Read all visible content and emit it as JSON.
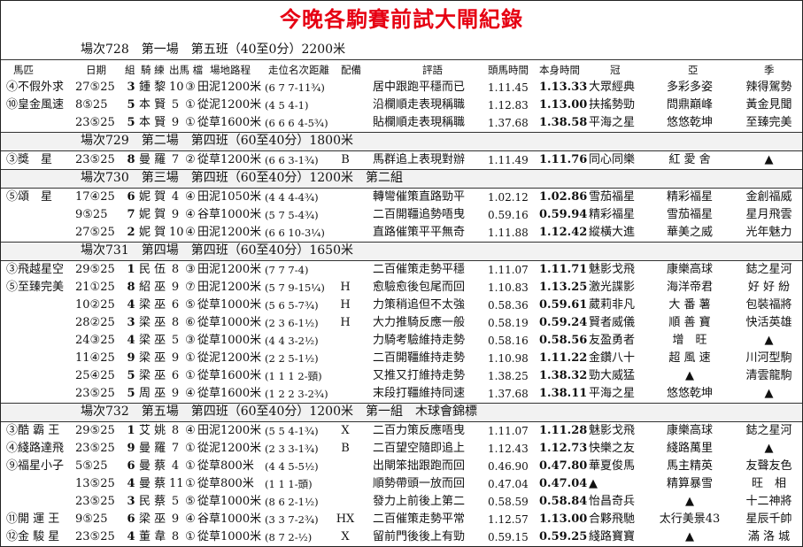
{
  "title": "今晚各駒賽前試大閘紀錄",
  "first_race_header": "場次728　第一場　第五班（40至0分）2200米",
  "columns": {
    "horse": "馬匹",
    "date": "日期",
    "group": "組",
    "jockey": "騎 練",
    "weight": "出馬 檔",
    "track": "場地路程",
    "running": "走位名次距離",
    "gear": "配備",
    "comment": "評語",
    "lead_time": "頭馬時間",
    "own_time": "本身時間",
    "first": "冠",
    "second": "亞",
    "third": "季"
  },
  "rows": [
    {
      "horse": "④不假外求",
      "date": "27⑤25",
      "group": "3",
      "jockey": "鍾 黎",
      "weight": "10",
      "gate": "③",
      "track": "田泥1200米",
      "running": "(6 7 7-11¾)",
      "gear": "",
      "comment": "居中跟跑平穩而已",
      "lead": "1.11.45",
      "own": "1.13.33",
      "first": "大眾經典",
      "second": "多彩多姿",
      "third": "辣得駕勢"
    },
    {
      "horse": "⑩皇金風速",
      "date": "8⑤25",
      "group": "5",
      "jockey": "本 賢",
      "weight": "5",
      "gate": "①",
      "track": "從泥1200米",
      "running": "(4 5 4-1)",
      "gear": "",
      "comment": "沿欄順走表現稱職",
      "lead": "1.12.83",
      "own": "1.13.00",
      "first": "扶搖勢勁",
      "second": "問鼎巔峰",
      "third": "黃金見聞"
    },
    {
      "horse": "",
      "date": "23⑤25",
      "group": "5",
      "jockey": "本 賢",
      "weight": "9",
      "gate": "①",
      "track": "從草1600米",
      "running": "(6 6 6 4-5¾)",
      "gear": "",
      "comment": "貼欄順走表現稱職",
      "lead": "1.37.68",
      "own": "1.38.58",
      "first": "平海之星",
      "second": "悠悠乾坤",
      "third": "至臻完美"
    },
    {
      "race": "場次729　第二場　第四班（60至40分）1800米"
    },
    {
      "horse": "③獎　星",
      "date": "23⑤25",
      "group": "8",
      "jockey": "曼 羅",
      "weight": "7",
      "gate": "②",
      "track": "從草1200米",
      "running": "(6 6 3-1¾)",
      "gear": "B",
      "comment": "馬群追上表現對辦",
      "lead": "1.11.49",
      "own": "1.11.76",
      "first": "同心同樂",
      "second": "紅 愛 舍",
      "third": "▲"
    },
    {
      "race": "場次730　第三場　第四班（60至40分）1200米　第二組"
    },
    {
      "horse": "⑤頌　星",
      "date": "17④25",
      "group": "6",
      "jockey": "妮 賀",
      "weight": "4",
      "gate": "④",
      "track": "田泥1050米",
      "running": "(4 4 4-4¾)",
      "gear": "",
      "comment": "轉彎催策直路勁平",
      "lead": "1.02.12",
      "own": "1.02.86",
      "first": "雪茄福星",
      "second": "精彩福星",
      "third": "金創福威"
    },
    {
      "horse": "",
      "date": "9⑤25",
      "group": "7",
      "jockey": "妮 賀",
      "weight": "9",
      "gate": "④",
      "track": "谷草1000米",
      "running": "(5 7 5-4¾)",
      "gear": "",
      "comment": "二百開韁追勢唔曳",
      "lead": "0.59.16",
      "own": "0.59.94",
      "first": "精彩福星",
      "second": "雪茄福星",
      "third": "星月飛雲"
    },
    {
      "horse": "",
      "date": "27⑤25",
      "group": "2",
      "jockey": "妮 賀",
      "weight": "10",
      "gate": "④",
      "track": "田泥1200米",
      "running": "(6 6 10-3¼)",
      "gear": "",
      "comment": "直路催策平平無奇",
      "lead": "1.11.88",
      "own": "1.12.42",
      "first": "縱橫大進",
      "second": "華美之威",
      "third": "光年魅力"
    },
    {
      "race": "場次731　第四場　第四班（60至40分）1650米"
    },
    {
      "horse": "③飛越星空",
      "date": "29⑤25",
      "group": "1",
      "jockey": "民 伍",
      "weight": "8",
      "gate": "③",
      "track": "田泥1200米",
      "running": "(7 7 7-4)",
      "gear": "",
      "comment": "二百催策走勢平穩",
      "lead": "1.11.07",
      "own": "1.11.71",
      "first": "魅影戈飛",
      "second": "康樂高球",
      "third": "鋕之星河"
    },
    {
      "horse": "⑤至臻完美",
      "date": "21①25",
      "group": "8",
      "jockey": "紹 巫",
      "weight": "9",
      "gate": "⑦",
      "track": "田泥1200米",
      "running": "(5 7 9-15¼)",
      "gear": "H",
      "comment": "愈驗愈後包尾而回",
      "lead": "1.10.83",
      "own": "1.13.25",
      "first": "激光諜影",
      "second": "海洋帝君",
      "third": "好 好 紛"
    },
    {
      "horse": "",
      "date": "10②25",
      "group": "4",
      "jockey": "梁 巫",
      "weight": "6",
      "gate": "⑤",
      "track": "從草1000米",
      "running": "(5 6 5-7¾)",
      "gear": "H",
      "comment": "力策稍追但不太強",
      "lead": "0.58.36",
      "own": "0.59.61",
      "first": "葳莉非凡",
      "second": "大 番 薯",
      "third": "包裝福將"
    },
    {
      "horse": "",
      "date": "28②25",
      "group": "3",
      "jockey": "梁 巫",
      "weight": "8",
      "gate": "⑥",
      "track": "從草1000米",
      "running": "(2 3 6-1½)",
      "gear": "H",
      "comment": "大力推騎反應一般",
      "lead": "0.58.19",
      "own": "0.59.24",
      "first": "賢者威儀",
      "second": "順 善 寶",
      "third": "快活英雄"
    },
    {
      "horse": "",
      "date": "24③25",
      "group": "4",
      "jockey": "梁 巫",
      "weight": "5",
      "gate": "③",
      "track": "從草1000米",
      "running": "(4 4 3-2½)",
      "gear": "",
      "comment": "力騎考驗維持走勢",
      "lead": "0.58.16",
      "own": "0.58.56",
      "first": "友盈勇者",
      "second": "增　旺",
      "third": "▲"
    },
    {
      "horse": "",
      "date": "11④25",
      "group": "9",
      "jockey": "梁 巫",
      "weight": "9",
      "gate": "①",
      "track": "從泥1200米",
      "running": "(2 2 5-1½)",
      "gear": "",
      "comment": "二百開韁維持走勢",
      "lead": "1.10.98",
      "own": "1.11.22",
      "first": "金鑽八十",
      "second": "超 風 速",
      "third": "川河型駒"
    },
    {
      "horse": "",
      "date": "25④25",
      "group": "5",
      "jockey": "梁 巫",
      "weight": "6",
      "gate": "①",
      "track": "從草1600米",
      "running": "(1 1 1 2-頸)",
      "gear": "",
      "comment": "又推又打維持走勢",
      "lead": "1.38.25",
      "own": "1.38.32",
      "first": "勁大威猛",
      "second": "▲",
      "third": "清雲龍駒"
    },
    {
      "horse": "",
      "date": "23⑤25",
      "group": "5",
      "jockey": "周 巫",
      "weight": "9",
      "gate": "④",
      "track": "從草1600米",
      "running": "(1 2 2 3-2¾)",
      "gear": "",
      "comment": "末段打韁維持同速",
      "lead": "1.37.68",
      "own": "1.38.11",
      "first": "平海之星",
      "second": "悠悠乾坤",
      "third": "▲"
    },
    {
      "race": "場次732　第五場　第四班（60至40分）1200米　第一組　木球會錦標"
    },
    {
      "horse": "③酷 霸 王",
      "date": "29⑤25",
      "group": "1",
      "jockey": "艾 姚",
      "weight": "8",
      "gate": "④",
      "track": "田泥1200米",
      "running": "(5 5 4-1¾)",
      "gear": "X",
      "comment": "二百力策反應唔曳",
      "lead": "1.11.07",
      "own": "1.11.28",
      "first": "魅影戈飛",
      "second": "康樂高球",
      "third": "鋕之星河"
    },
    {
      "horse": "④綫路達飛",
      "date": "23⑤25",
      "group": "9",
      "jockey": "曼 羅",
      "weight": "7",
      "gate": "①",
      "track": "從泥1200米",
      "running": "(2 3 3-1¾)",
      "gear": "B",
      "comment": "二百望空隨即追上",
      "lead": "1.12.43",
      "own": "1.12.73",
      "first": "快樂之友",
      "second": "綫路萬里",
      "third": "▲"
    },
    {
      "horse": "⑨福星小子",
      "date": "5⑤25",
      "group": "6",
      "jockey": "曼 蔡",
      "weight": "4",
      "gate": "①",
      "track": "從草800米",
      "running": "(4 4 5-5½)",
      "gear": "",
      "comment": "出閘笨拙跟跑而回",
      "lead": "0.46.90",
      "own": "0.47.80",
      "first": "華夏俊馬",
      "second": "馬主精英",
      "third": "友聲友色"
    },
    {
      "horse": "",
      "date": "13⑤25",
      "group": "4",
      "jockey": "曼 蔡",
      "weight": "11",
      "gate": "①",
      "track": "從草800米",
      "running": "(1 1 1-頭)",
      "gear": "",
      "comment": "順勢帶頭一放而回",
      "lead": "0.47.04",
      "own": "0.47.04",
      "first": "▲",
      "second": "精算暴雪",
      "third": "旺　相"
    },
    {
      "horse": "",
      "date": "23⑤25",
      "group": "3",
      "jockey": "民 蔡",
      "weight": "5",
      "gate": "⑤",
      "track": "從草1000米",
      "running": "(8 6 2-1½)",
      "gear": "",
      "comment": "發力上前後上第二",
      "lead": "0.58.59",
      "own": "0.58.84",
      "first": "怡昌奇兵",
      "second": "▲",
      "third": "十二神將"
    },
    {
      "horse": "⑪開 運 王",
      "date": "9⑤25",
      "group": "6",
      "jockey": "梁 巫",
      "weight": "9",
      "gate": "④",
      "track": "谷草1000米",
      "running": "(3 3 7-2¾)",
      "gear": "HX",
      "comment": "二百催策走勢平常",
      "lead": "1.12.57",
      "own": "1.13.00",
      "first": "合夥飛馳",
      "second": "太行美景43",
      "third": "星辰千帥"
    },
    {
      "horse": "⑫金 駿 星",
      "date": "23⑤25",
      "group": "4",
      "jockey": "董 韋",
      "weight": "8",
      "gate": "①",
      "track": "從草1000米",
      "running": "(8 7 2-½)",
      "gear": "X",
      "comment": "留前門後後上有勁",
      "lead": "0.59.15",
      "own": "0.59.25",
      "first": "綫路寶寶",
      "second": "▲",
      "third": "滿 洛 城"
    }
  ]
}
